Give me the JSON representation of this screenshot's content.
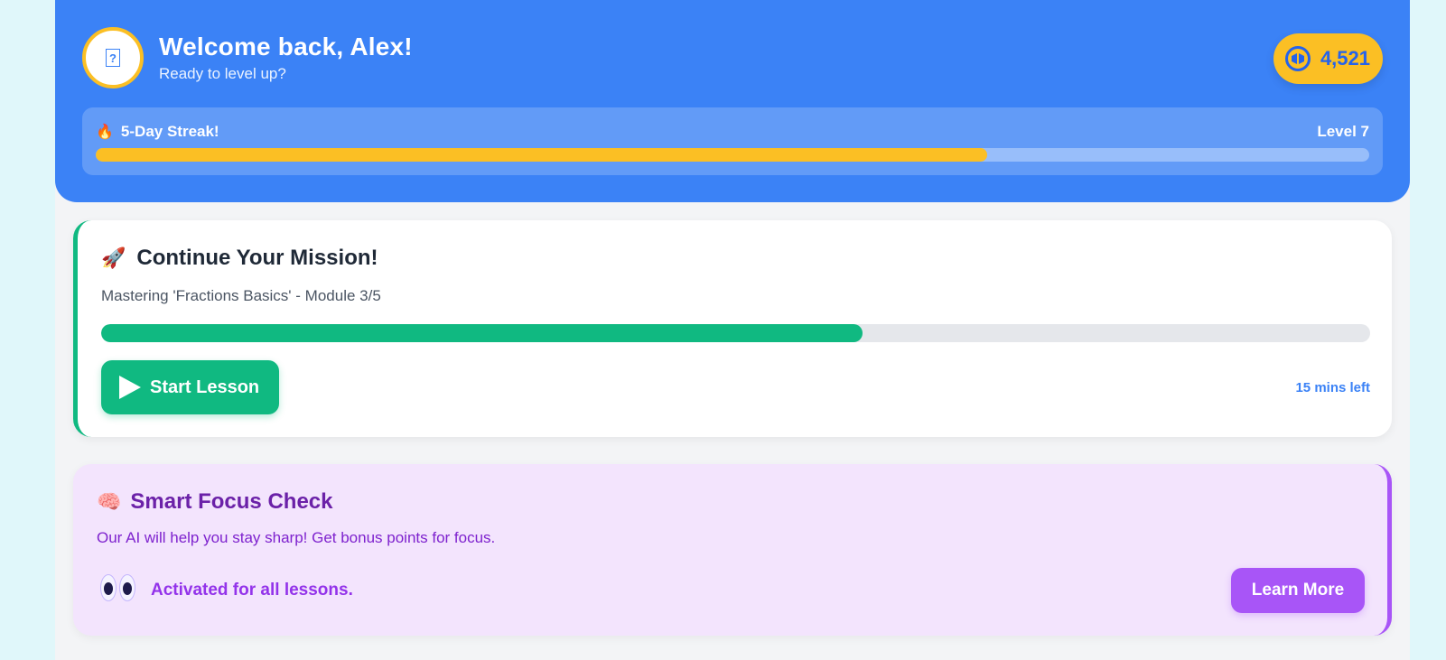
{
  "header": {
    "avatar_glyph": "?",
    "welcome": "Welcome back, Alex!",
    "subtitle": "Ready to level up?",
    "points": "4,521",
    "streak_label": "5-Day Streak!",
    "level_label": "Level 7",
    "xp_progress": 0.7
  },
  "mission": {
    "title": "Continue Your Mission!",
    "description": "Mastering 'Fractions Basics' - Module 3/5",
    "progress": 0.6,
    "start_label": "Start Lesson",
    "time_left": "15 mins left"
  },
  "focus": {
    "title": "Smart Focus Check",
    "description": "Our AI will help you stay sharp! Get bonus points for focus.",
    "status": "Activated for all lessons.",
    "learn_more_label": "Learn More"
  },
  "colors": {
    "header_bg": "#3b82f6",
    "accent_gold": "#fbbf24",
    "mission_green": "#10b981",
    "focus_purple": "#a855f7"
  },
  "icons": [
    "avatar-icon",
    "coin-icon",
    "flame-icon",
    "rocket-icon",
    "play-icon",
    "brain-icon",
    "eyes-icon"
  ]
}
